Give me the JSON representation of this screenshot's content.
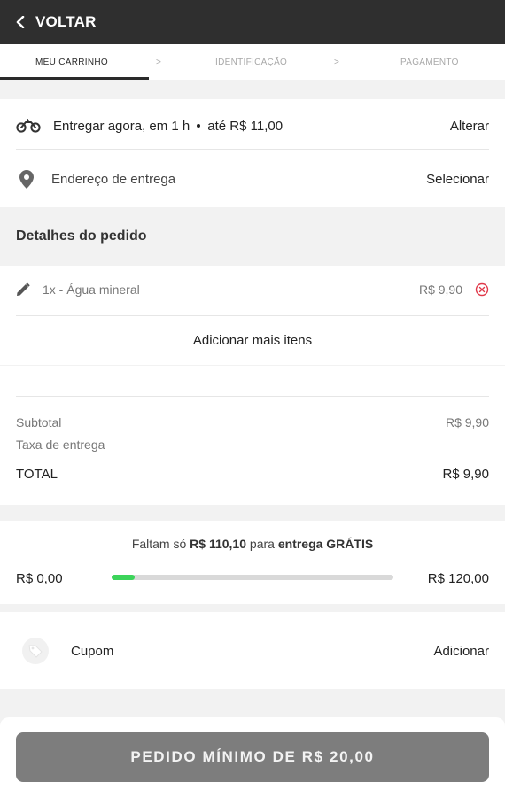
{
  "header": {
    "back_label": "VOLTAR"
  },
  "steps": {
    "items": [
      "MEU CARRINHO",
      "IDENTIFICAÇÃO",
      "PAGAMENTO"
    ],
    "separator": ">"
  },
  "delivery": {
    "when": "Entregar agora, em 1 h",
    "until": "até R$ 11,00",
    "change_label": "Alterar",
    "address_label": "Endereço de entrega",
    "select_label": "Selecionar"
  },
  "order": {
    "section_title": "Detalhes do pedido",
    "items": [
      {
        "label": "1x - Água mineral",
        "price": "R$ 9,90"
      }
    ],
    "add_more_label": "Adicionar mais itens"
  },
  "summary": {
    "subtotal_label": "Subtotal",
    "subtotal_value": "R$ 9,90",
    "fee_label": "Taxa de entrega",
    "total_label": "TOTAL",
    "total_value": "R$ 9,90"
  },
  "free_shipping": {
    "prefix": "Faltam só",
    "amount": "R$ 110,10",
    "middle": "para",
    "suffix": "entrega GRÁTIS",
    "min_label": "R$ 0,00",
    "max_label": "R$ 120,00",
    "progress_fraction": 0.0825
  },
  "coupon": {
    "label": "Cupom",
    "add_label": "Adicionar"
  },
  "footer": {
    "button_label": "PEDIDO MÍNIMO DE R$ 20,00"
  },
  "icons": {
    "back": "chevron-left-icon",
    "moto": "motorcycle-icon",
    "location": "location-pin-icon",
    "edit": "pencil-icon",
    "remove": "remove-circle-icon",
    "coupon": "coupon-tag-icon"
  },
  "colors": {
    "progress": "#3cd45a",
    "remove": "#e0394a",
    "topbar": "#2f2f2f",
    "button": "#7d7d7d"
  }
}
